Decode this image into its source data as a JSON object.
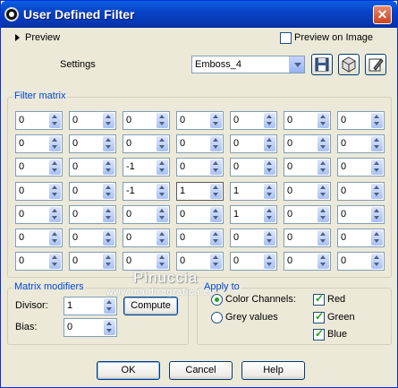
{
  "window": {
    "title": "User Defined Filter",
    "close_glyph": "✕"
  },
  "preview": {
    "label": "Preview",
    "preview_on_image_label": "Preview on Image",
    "preview_on_image_checked": false
  },
  "settings": {
    "label": "Settings",
    "preset_value": "Emboss_4",
    "toolbar_icons": [
      "save-icon",
      "cube-icon",
      "edit-preset-icon"
    ]
  },
  "filter_matrix": {
    "label": "Filter matrix",
    "rows": [
      [
        "0",
        "0",
        "0",
        "0",
        "0",
        "0",
        "0"
      ],
      [
        "0",
        "0",
        "0",
        "0",
        "0",
        "0",
        "0"
      ],
      [
        "0",
        "0",
        "-1",
        "0",
        "0",
        "0",
        "0"
      ],
      [
        "0",
        "0",
        "-1",
        "1",
        "1",
        "0",
        "0"
      ],
      [
        "0",
        "0",
        "0",
        "0",
        "1",
        "0",
        "0"
      ],
      [
        "0",
        "0",
        "0",
        "0",
        "0",
        "0",
        "0"
      ],
      [
        "0",
        "0",
        "0",
        "0",
        "0",
        "0",
        "0"
      ]
    ]
  },
  "matrix_modifiers": {
    "label": "Matrix modifiers",
    "divisor_label": "Divisor:",
    "divisor_value": "1",
    "compute_label": "Compute",
    "bias_label": "Bias:",
    "bias_value": "0"
  },
  "apply_to": {
    "label": "Apply to",
    "color_channels_label": "Color Channels:",
    "color_channels_selected": true,
    "grey_values_label": "Grey values",
    "red_label": "Red",
    "green_label": "Green",
    "blue_label": "Blue",
    "red_checked": true,
    "green_checked": true,
    "blue_checked": true
  },
  "watermark": {
    "name": "Pinuccia",
    "site": "www.maidiragrafica.eu"
  },
  "buttons": {
    "ok": "OK",
    "cancel": "Cancel",
    "help": "Help"
  }
}
